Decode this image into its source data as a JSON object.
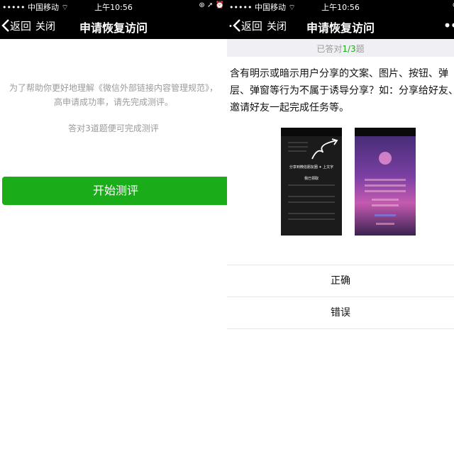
{
  "status_bar": {
    "left": "••••• 中国移动 ⌔",
    "time": "上午10:56",
    "right": "⊛ ➚ ⏰"
  },
  "nav": {
    "back_label": "返回",
    "close_label": "关闭",
    "title": "申请恢复访问",
    "more_label": "•••"
  },
  "intro_screen": {
    "intro_line1": "为了帮助你更好地理解《微信外部链接内容管理规范》，",
    "intro_line2": "高申请成功率，请先完成测评。",
    "hint": "答对3道题便可完成测评",
    "start_button": "开始测评"
  },
  "quiz_screen": {
    "progress_prefix": "已答对",
    "progress_value": "1/3",
    "progress_suffix": "题",
    "question_line1": "含有明示或暗示用户分享的文案、图片、按钮、弹",
    "question_line2": "层、弹窗等行为不属于诱导分享？如：分享给好友、",
    "question_line3": "邀请好友一起完成任务等。",
    "example_a_share": "分享到微信朋友圈 ✦ 上文字",
    "example_a_claim": "我已领取",
    "answers": [
      "正确",
      "错误"
    ]
  },
  "colors": {
    "accent": "#1aad19",
    "navbar": "#000000",
    "muted_text": "#9b9b9b"
  }
}
